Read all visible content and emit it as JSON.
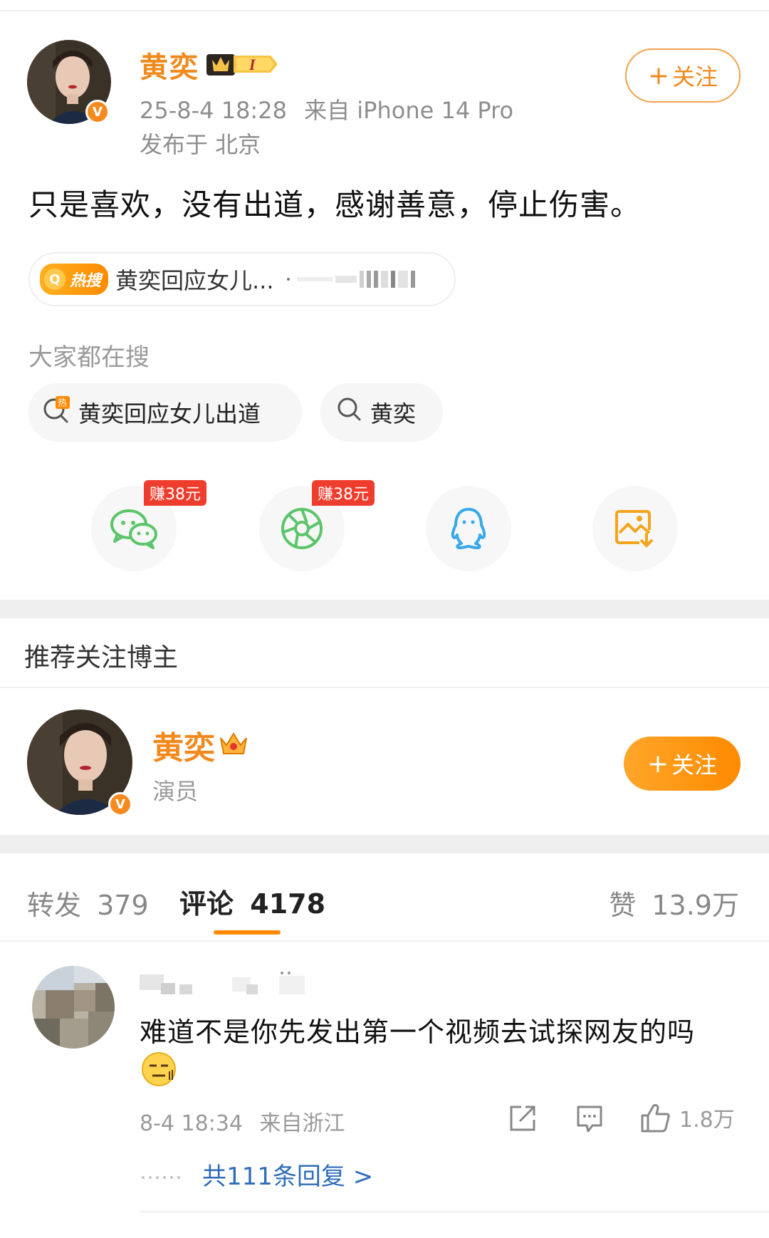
{
  "post": {
    "author_name": "黄奕",
    "vip_badge": "I",
    "timestamp": "25-8-4 18:28",
    "source": "来自 iPhone 14 Pro",
    "location": "发布于 北京",
    "follow_label": "关注",
    "content": "只是喜欢，没有出道，感谢善意，停止伤害。",
    "hot_tag": "热搜",
    "hot_search_text": "黄奕回应女儿...",
    "hot_search_dot": "·"
  },
  "searches": {
    "title": "大家都在搜",
    "chips": [
      {
        "label": "黄奕回应女儿出道",
        "icon": "hot-search-icon"
      },
      {
        "label": "黄奕",
        "icon": "search-icon"
      }
    ]
  },
  "share": {
    "items": [
      {
        "icon": "wechat-icon",
        "badge": "赚38元",
        "color": "#5cc46a"
      },
      {
        "icon": "moments-icon",
        "badge": "赚38元",
        "color": "#5cc46a"
      },
      {
        "icon": "qq-icon",
        "badge": "",
        "color": "#37a8ea"
      },
      {
        "icon": "save-image-icon",
        "badge": "",
        "color": "#f3a51d"
      }
    ]
  },
  "recommend": {
    "title": "推荐关注博主",
    "name": "黄奕",
    "role": "演员",
    "follow_label": "关注"
  },
  "tabs": {
    "repost_label": "转发",
    "repost_count": "379",
    "comment_label": "评论",
    "comment_count": "4178",
    "like_label": "赞",
    "like_count": "13.9万"
  },
  "comment": {
    "text": "难道不是你先发出第一个视频去试探网友的吗",
    "emoji": "😑",
    "time": "8-4 18:34",
    "location": "来自浙江",
    "like_count": "1.8万",
    "replies_prefix": "……",
    "replies_label": "共111条回复 >"
  },
  "colors": {
    "accent": "#ff8a00",
    "name": "#f08a1d",
    "link": "#2f6db8"
  }
}
